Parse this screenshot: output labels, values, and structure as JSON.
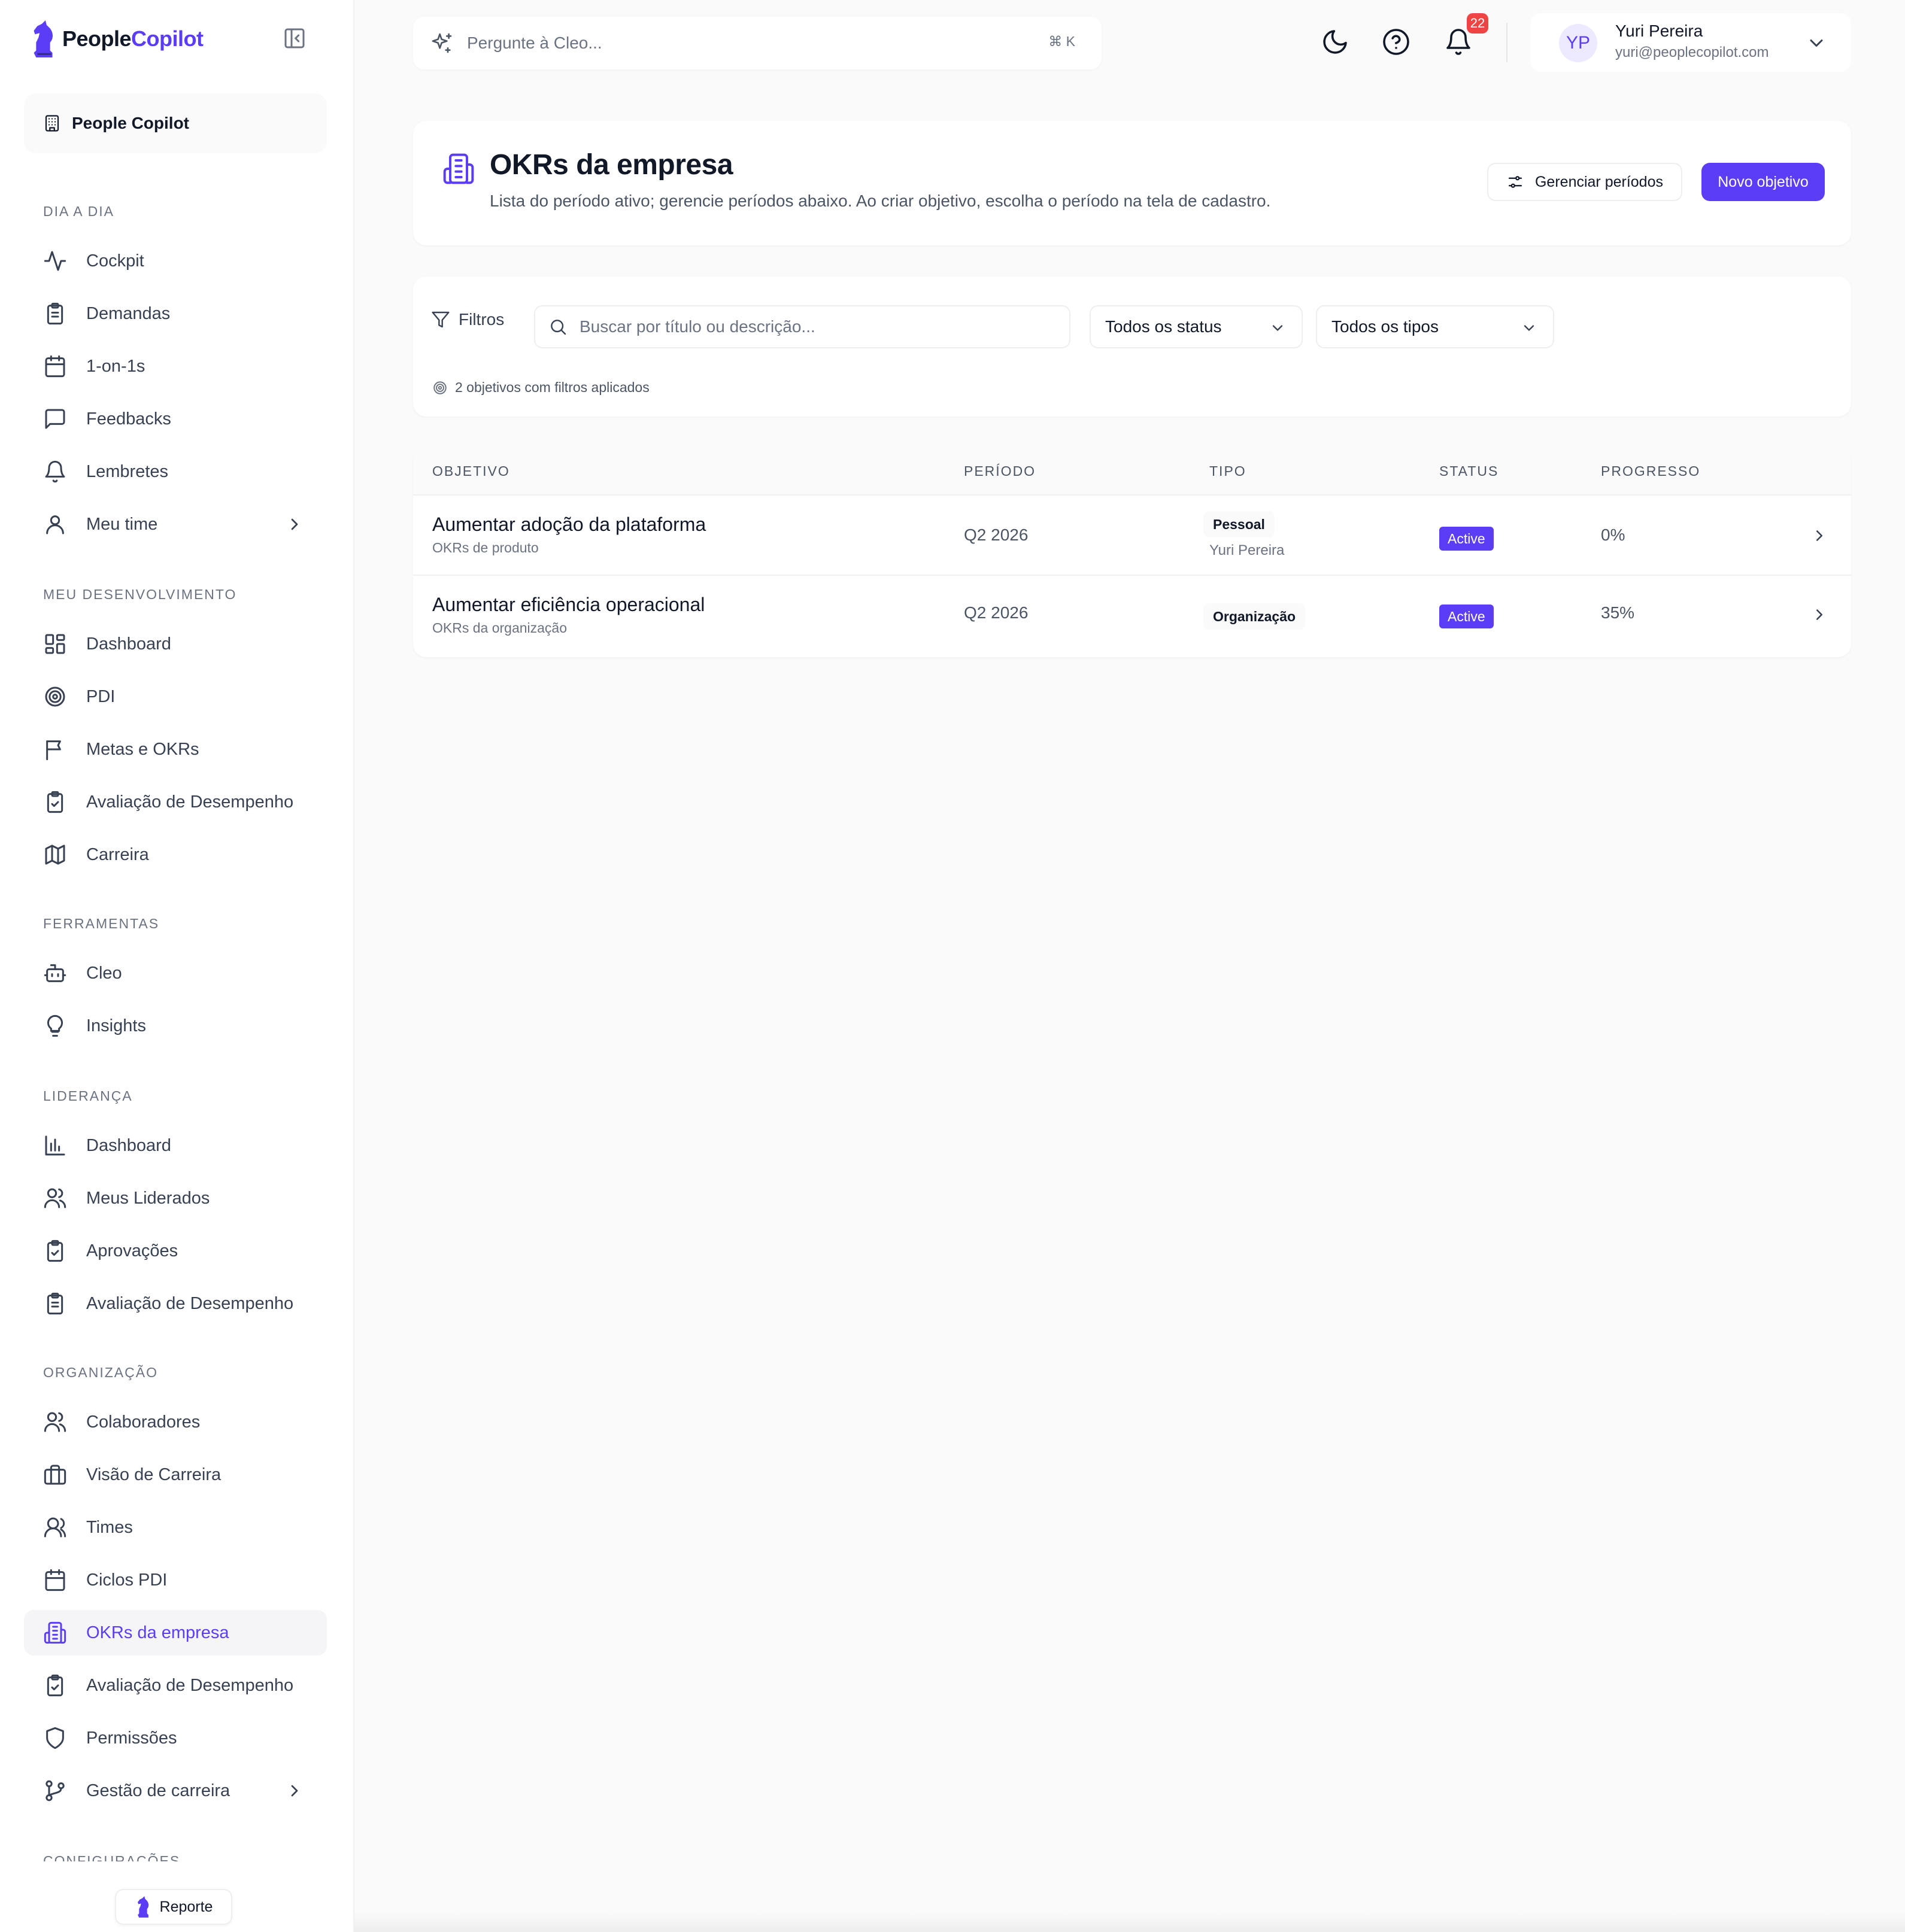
{
  "brand": {
    "name_part1": "People",
    "name_part2": "Copilot",
    "accent": "#5b3df5"
  },
  "org": {
    "label": "People Copilot"
  },
  "sections": {
    "dia_a_dia": "DIA A DIA",
    "meu_desenvolvimento": "MEU DESENVOLVIMENTO",
    "ferramentas": "FERRAMENTAS",
    "lideranca": "LIDERANÇA",
    "organizacao": "ORGANIZAÇÃO",
    "configuracoes": "CONFIGURAÇÕES"
  },
  "nav": {
    "cockpit": "Cockpit",
    "demandas": "Demandas",
    "one_on_ones": "1-on-1s",
    "feedbacks": "Feedbacks",
    "lembretes": "Lembretes",
    "meu_time": "Meu time",
    "dashboard": "Dashboard",
    "pdi": "PDI",
    "metas_okrs": "Metas e OKRs",
    "avaliacao": "Avaliação de Desempenho",
    "carreira": "Carreira",
    "cleo": "Cleo",
    "insights": "Insights",
    "lid_dashboard": "Dashboard",
    "meus_liderados": "Meus Liderados",
    "aprovacoes": "Aprovações",
    "lid_avaliacao": "Avaliação de Desempenho",
    "colaboradores": "Colaboradores",
    "visao_carreira": "Visão de Carreira",
    "times": "Times",
    "ciclos_pdi": "Ciclos PDI",
    "okrs_empresa": "OKRs da empresa",
    "org_avaliacao": "Avaliação de Desempenho",
    "permissoes": "Permissões",
    "gestao_carreira": "Gestão de carreira"
  },
  "reporte": "Reporte",
  "topbar": {
    "search_placeholder": "Pergunte à Cleo...",
    "shortcut": "⌘ K",
    "notification_count": "22",
    "icons": [
      "moon-icon",
      "help-icon",
      "bell-icon"
    ]
  },
  "user": {
    "initials": "YP",
    "name": "Yuri Pereira",
    "email": "yuri@peoplecopilot.com"
  },
  "header": {
    "title": "OKRs da empresa",
    "subtitle": "Lista do período ativo; gerencie períodos abaixo. Ao criar objetivo, escolha o período na tela de cadastro.",
    "manage_label": "Gerenciar períodos",
    "new_label": "Novo objetivo"
  },
  "filters": {
    "label": "Filtros",
    "search_placeholder": "Buscar por título ou descrição...",
    "status_select": "Todos os status",
    "type_select": "Todos os tipos",
    "count_text": "2 objetivos com filtros aplicados"
  },
  "table": {
    "columns": [
      "OBJETIVO",
      "PERÍODO",
      "TIPO",
      "STATUS",
      "PROGRESSO"
    ],
    "rows": [
      {
        "title": "Aumentar adoção da plataforma",
        "subtitle": "OKRs de produto",
        "period": "Q2 2026",
        "type": "Pessoal",
        "type_owner": "Yuri Pereira",
        "status": "Active",
        "progress": "0%"
      },
      {
        "title": "Aumentar eficiência operacional",
        "subtitle": "OKRs da organização",
        "period": "Q2 2026",
        "type": "Organização",
        "status": "Active",
        "progress": "35%"
      }
    ]
  }
}
